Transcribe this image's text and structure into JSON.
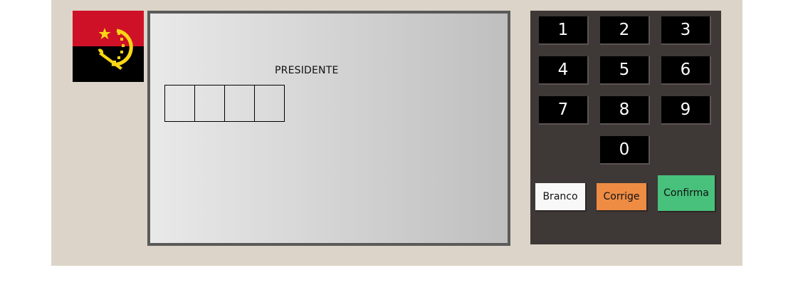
{
  "flag": {
    "icon": "angola-flag-icon",
    "colors": {
      "top": "#ce1126",
      "bottom": "#000000",
      "emblem": "#f9d616"
    }
  },
  "screen": {
    "office_label": "PRESIDENTE",
    "digit_boxes": 4
  },
  "keypad": {
    "keys": [
      "1",
      "2",
      "3",
      "4",
      "5",
      "6",
      "7",
      "8",
      "9",
      "0"
    ],
    "blank_label": "Branco",
    "correct_label": "Corrige",
    "confirm_label": "Confirma",
    "colors": {
      "blank": "#f8f8f8",
      "correct": "#ee8c44",
      "confirm": "#47c17b"
    }
  }
}
